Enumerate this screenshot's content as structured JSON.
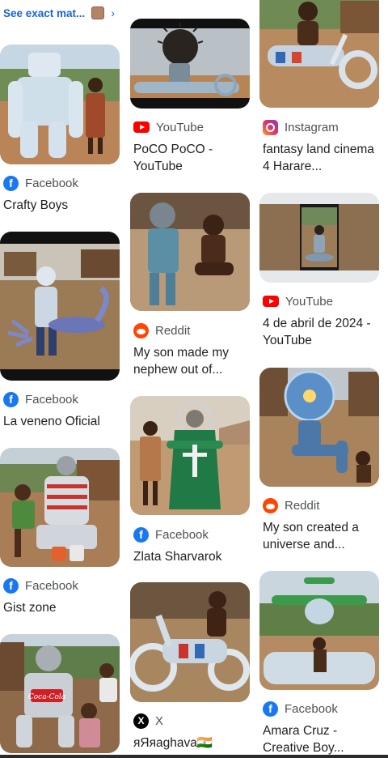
{
  "exact_match": {
    "label": "See exact mat...",
    "chevron": "›",
    "icon": "thumbnail-icon"
  },
  "icons": {
    "facebook": "f",
    "x": "X"
  },
  "colors": {
    "link_blue": "#1a63d2",
    "facebook": "#1877f2",
    "youtube": "#ff0000",
    "reddit": "#ff4500",
    "source_text": "#4d5156"
  },
  "results": {
    "c1": [
      {
        "source": "Facebook",
        "icon": "facebook-icon",
        "title": "Crafty Boys"
      },
      {
        "source": "Facebook",
        "icon": "facebook-icon",
        "title": "La veneno Oficial"
      },
      {
        "source": "Facebook",
        "icon": "facebook-icon",
        "title": "Gist zone"
      },
      {
        "source": "",
        "icon": "",
        "title": ""
      }
    ],
    "c2": [
      {
        "source": "YouTube",
        "icon": "youtube-icon",
        "title": "PoCO PoCO - YouTube"
      },
      {
        "source": "Reddit",
        "icon": "reddit-icon",
        "title": "My son made my nephew out of..."
      },
      {
        "source": "Facebook",
        "icon": "facebook-icon",
        "title": "Zlata Sharvarok"
      },
      {
        "source": "X",
        "icon": "x-icon",
        "title": "яЯяaghava🇮🇳"
      }
    ],
    "c3": [
      {
        "source": "Instagram",
        "icon": "instagram-icon",
        "title": "fantasy land cinema 4 Harare..."
      },
      {
        "source": "YouTube",
        "icon": "youtube-icon",
        "title": "4 de abril de 2024 - YouTube"
      },
      {
        "source": "Reddit",
        "icon": "reddit-icon",
        "title": "My son created a universe and..."
      },
      {
        "source": "Facebook",
        "icon": "facebook-icon",
        "title": "Amara Cruz - Creative Boy..."
      }
    ]
  }
}
